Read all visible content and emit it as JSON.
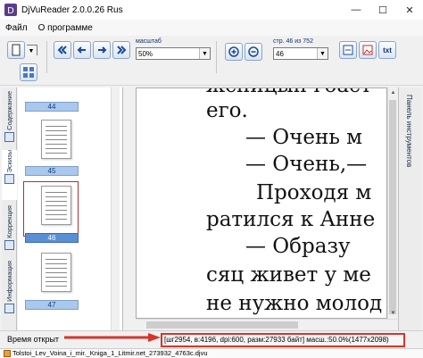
{
  "window": {
    "title": "DjVuReader 2.0.0.26 Rus",
    "minimize": "—",
    "maximize": "☐",
    "close": "✕"
  },
  "menu": [
    "Файл",
    "О программе"
  ],
  "toolbar": {
    "zoom_label": "масштаб",
    "zoom_value": "50%",
    "page_label": "стр. 46 из 752",
    "page_value": "46",
    "txt_label": "txt"
  },
  "left_tabs": [
    "Содержание",
    "Эскизы",
    "Коррекция",
    "Информация"
  ],
  "thumbnails": [
    {
      "number": "44",
      "selected": false
    },
    {
      "number": "45",
      "selected": false
    },
    {
      "number": "46",
      "selected": true
    },
    {
      "number": "47",
      "selected": false
    }
  ],
  "document_lines": [
    "жсницын гоаст",
    "его.",
    "— Очень м",
    "— Очень,—",
    "Проходя м",
    "ратился к Анне",
    "— Образу",
    "сяц живет у ме",
    "не нужно молод"
  ],
  "right_panel": {
    "label": "Панель инструментов"
  },
  "status": {
    "time_label": "Время открыт",
    "info": "[шг2954, в:4196, dpi:600, разм:27933 байт] масш.:50.0%(1477x2098)"
  },
  "file_tab": "Tolstoi_Lev_Voina_i_mir._Kniga_1_Litmir.net_273932_4763c.djvu",
  "colors": {
    "highlight": "#d9342b",
    "thumb_label": "#aac8ec",
    "thumb_selected": "#5a8fd6"
  }
}
